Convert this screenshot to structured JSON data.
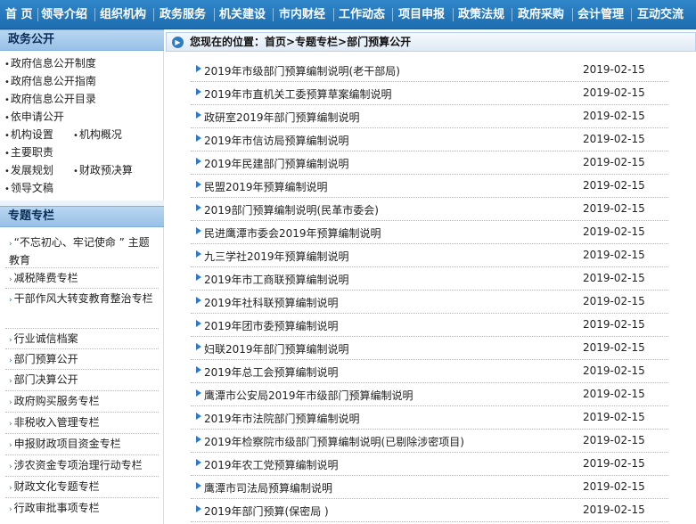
{
  "topnav": {
    "items": [
      "首 页",
      "领导介绍",
      "组织机构",
      "政务服务",
      "机关建设",
      "市内财经",
      "工作动态",
      "项目申报",
      "政策法规",
      "政府采购",
      "会计管理",
      "互动交流"
    ]
  },
  "sidebar": {
    "gov_title": "政务公开",
    "gov_items": [
      "政府信息公开制度",
      "政府信息公开指南",
      "政府信息公开目录",
      "依申请公开",
      "机构设置",
      "机构概况",
      "主要职责",
      "发展规划",
      "财政预决算",
      "领导文稿"
    ],
    "topic_title": "专题专栏",
    "topic_items": [
      "“不忘初心、牢记使命 ” 主题教育",
      "减税降费专栏",
      "干部作风大转变教育整治专栏",
      "行业诚信档案",
      "部门预算公开",
      "部门决算公开",
      "政府购买服务专栏",
      "非税收入管理专栏",
      "申报财政项目资金专栏",
      "涉农资金专项治理行动专栏",
      "财政文化专题专栏",
      "行政审批事项专栏"
    ]
  },
  "breadcrumb": {
    "text": "您现在的位置：首页>专题专栏>部门预算公开"
  },
  "list": [
    {
      "title": "2019年市级部门预算编制说明(老干部局)",
      "date": "2019-02-15"
    },
    {
      "title": "2019年市直机关工委预算草案编制说明",
      "date": "2019-02-15"
    },
    {
      "title": "政研室2019年部门预算编制说明",
      "date": "2019-02-15"
    },
    {
      "title": "2019年市信访局预算编制说明",
      "date": "2019-02-15"
    },
    {
      "title": "2019年民建部门预算编制说明",
      "date": "2019-02-15"
    },
    {
      "title": "民盟2019年预算编制说明",
      "date": "2019-02-15"
    },
    {
      "title": "2019部门预算编制说明(民革市委会)",
      "date": "2019-02-15"
    },
    {
      "title": "民进鹰潭市委会2019年预算编制说明",
      "date": "2019-02-15"
    },
    {
      "title": "九三学社2019年预算编制说明",
      "date": "2019-02-15"
    },
    {
      "title": "2019年市工商联预算编制说明",
      "date": "2019-02-15"
    },
    {
      "title": "2019年社科联预算编制说明",
      "date": "2019-02-15"
    },
    {
      "title": "2019年团市委预算编制说明",
      "date": "2019-02-15"
    },
    {
      "title": "妇联2019年部门预算编制说明",
      "date": "2019-02-15"
    },
    {
      "title": "2019年总工会预算编制说明",
      "date": "2019-02-15"
    },
    {
      "title": "鹰潭市公安局2019年市级部门预算编制说明",
      "date": "2019-02-15"
    },
    {
      "title": "2019年市法院部门预算编制说明",
      "date": "2019-02-15"
    },
    {
      "title": "2019年检察院市级部门预算编制说明(已剔除涉密项目)",
      "date": "2019-02-15"
    },
    {
      "title": "2019年农工党预算编制说明",
      "date": "2019-02-15"
    },
    {
      "title": "鹰潭市司法局预算编制说明",
      "date": "2019-02-15"
    },
    {
      "title": "2019年部门预算(保密局 )",
      "date": "2019-02-15"
    }
  ]
}
